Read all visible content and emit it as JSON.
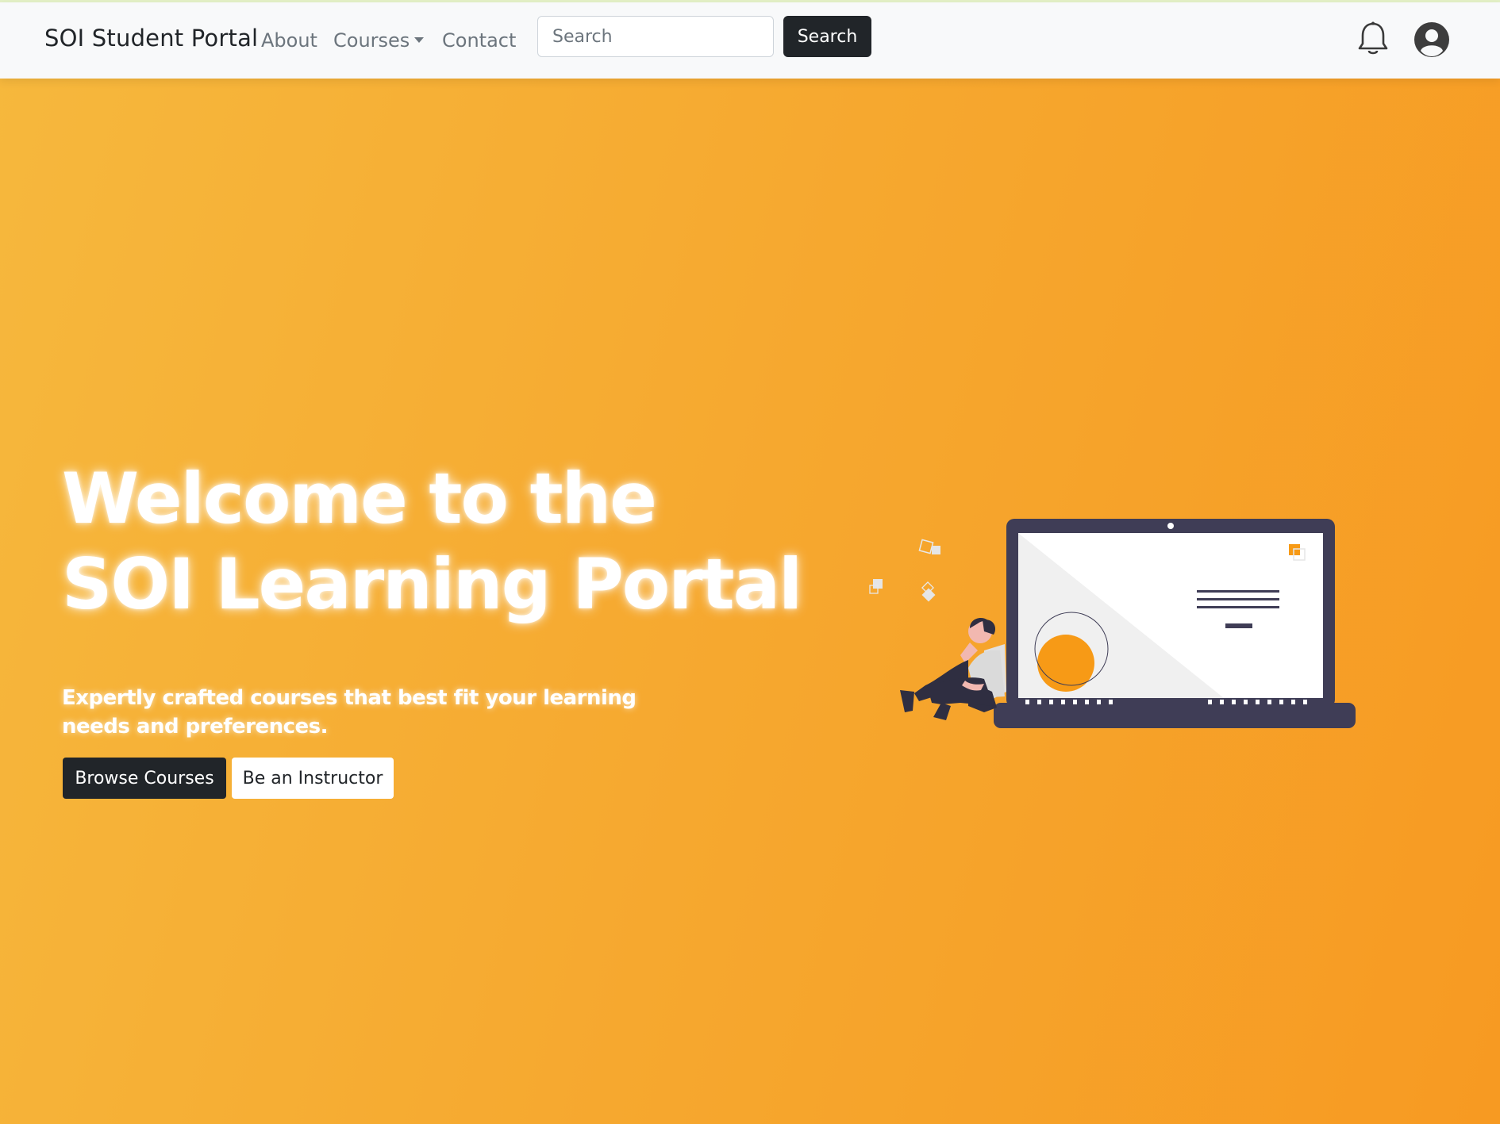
{
  "navbar": {
    "brand": "SOI Student Portal",
    "links": {
      "about": "About",
      "courses": "Courses",
      "contact": "Contact"
    },
    "search": {
      "placeholder": "Search",
      "button_label": "Search"
    },
    "icons": [
      "bell-icon",
      "user-avatar-icon"
    ]
  },
  "hero": {
    "title_line1": "Welcome to the",
    "title_line2": "SOI Learning Portal",
    "subtitle": "Expertly crafted courses that best fit your learning needs and preferences.",
    "buttons": {
      "browse": "Browse Courses",
      "instructor": "Be an Instructor"
    }
  },
  "colors": {
    "navbar_bg": "#f8f9fa",
    "hero_gradient_start": "#f6b83d",
    "hero_gradient_end": "#f79a22",
    "dark_button": "#212529",
    "illustration_dark": "#3f3d56",
    "illustration_accent": "#f79a16"
  }
}
